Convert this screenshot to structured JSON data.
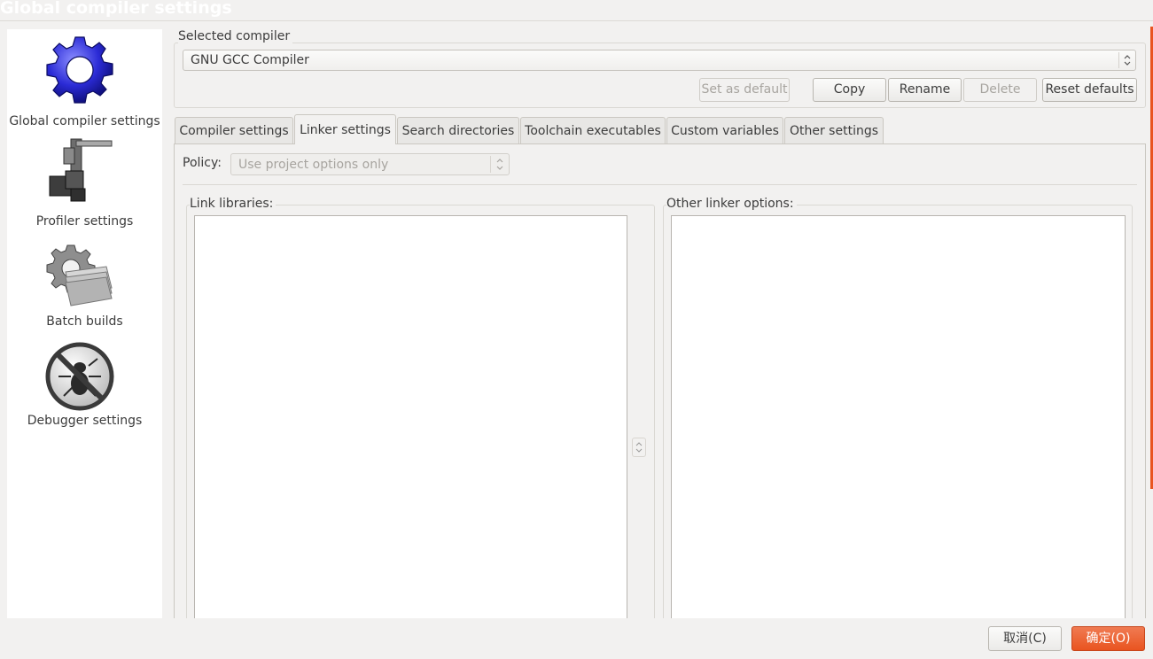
{
  "window": {
    "title": "Global compiler settings"
  },
  "sidebar": {
    "items": [
      {
        "label": "Global compiler settings",
        "icon": "gear-icon"
      },
      {
        "label": "Profiler settings",
        "icon": "caliper-icon"
      },
      {
        "label": "Batch builds",
        "icon": "gear-stack-icon"
      },
      {
        "label": "Debugger settings",
        "icon": "no-bug-icon"
      }
    ]
  },
  "compiler": {
    "group_label": "Selected compiler",
    "selected": "GNU GCC Compiler",
    "buttons": {
      "set_default": "Set as default",
      "copy": "Copy",
      "rename": "Rename",
      "delete": "Delete",
      "reset": "Reset defaults"
    }
  },
  "tabs": [
    {
      "label": "Compiler settings"
    },
    {
      "label": "Linker settings"
    },
    {
      "label": "Search directories"
    },
    {
      "label": "Toolchain executables"
    },
    {
      "label": "Custom variables"
    },
    {
      "label": "Other settings"
    }
  ],
  "linker": {
    "policy_label": "Policy:",
    "policy_value": "Use project options only",
    "link_libraries_label": "Link libraries:",
    "other_options_label": "Other linker options:"
  },
  "dialog": {
    "cancel": "取消(C)",
    "ok": "确定(O)"
  },
  "colors": {
    "accent": "#e95420"
  }
}
